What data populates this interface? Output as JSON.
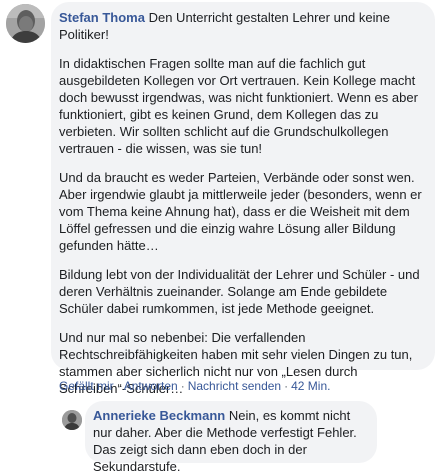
{
  "comment": {
    "author": "Stefan Thoma",
    "first_line": "Den Unterricht gestalten Lehrer und keine Politiker!",
    "paragraphs": [
      "In didaktischen Fragen sollte man auf die fachlich gut ausgebildeten Kollegen vor Ort vertrauen. Kein Kollege macht doch bewusst irgendwas, was nicht funktioniert. Wenn es aber funktioniert, gibt es keinen Grund, dem Kollegen das zu verbieten. Wir sollten schlicht auf die Grundschulkollegen vertrauen - die wissen, was sie tun!",
      "Und da braucht es weder Parteien, Verbände oder sonst wen. Aber irgendwie glaubt ja mittlerweile jeder (besonders, wenn er vom Thema keine Ahnung hat), dass er die Weisheit mit dem Löffel gefressen und die einzig wahre Lösung aller Bildung gefunden hätte…",
      "Bildung lebt von der Individualität der Lehrer und Schüler - und deren Verhältnis zueinander. Solange am Ende gebildete Schüler dabei rumkommen, ist jede Methode geeignet.",
      "Und nur mal so nebenbei: Die verfallenden Rechtschreibfähigkeiten haben mit sehr vielen Dingen zu tun, stammen aber sicherlich nicht nur von „Lesen durch Schreiben“-Schüler…"
    ],
    "actions": {
      "like": "Gefällt mir",
      "reply": "Antworten",
      "message": "Nachricht senden",
      "time": "42 Min."
    },
    "separator": "·"
  },
  "reply": {
    "author": "Annerieke Beckmann",
    "text": "Nein, es kommt nicht nur daher. Aber die Methode verfestigt Fehler. Das zeigt sich dann eben doch in der Sekundarstufe."
  }
}
